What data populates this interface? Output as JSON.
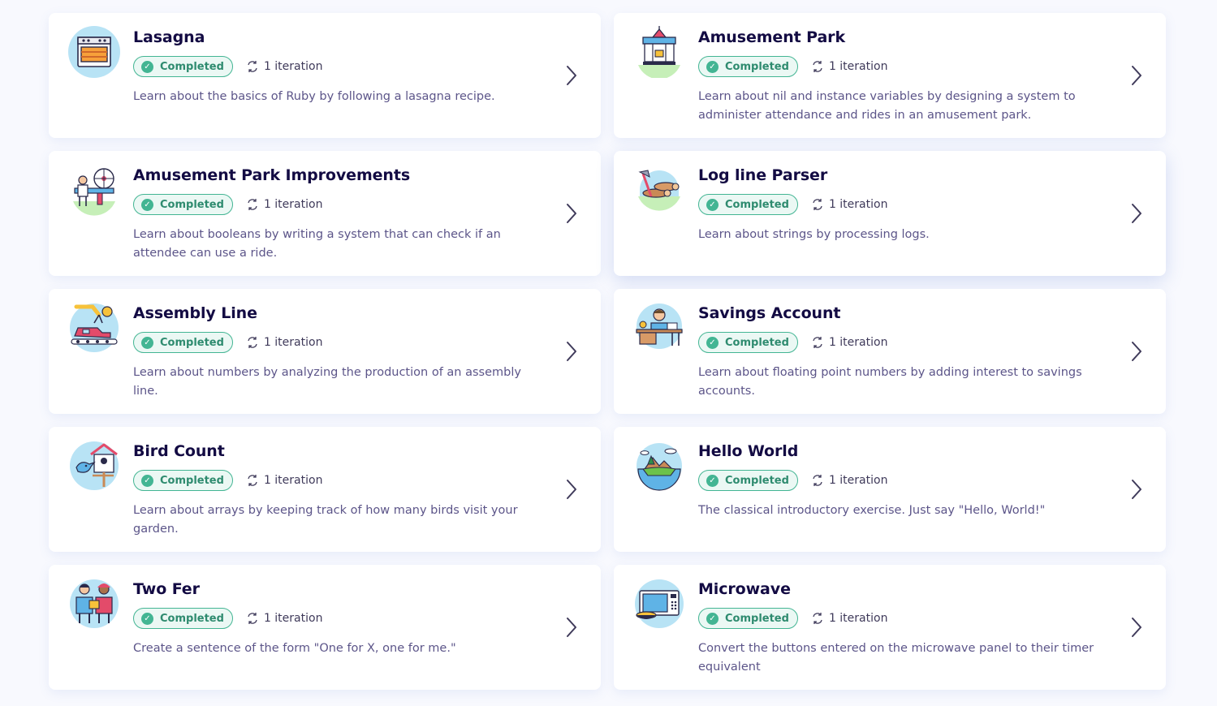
{
  "exercises": [
    {
      "title": "Lasagna",
      "status": "Completed",
      "iterations": "1 iteration",
      "description": "Learn about the basics of Ruby by following a lasagna recipe.",
      "icon": "lasagna-oven-icon",
      "accent": "#b8e3f5"
    },
    {
      "title": "Amusement Park",
      "status": "Completed",
      "iterations": "1 iteration",
      "description": "Learn about nil and instance variables by designing a system to administer attendance and rides in an amusement park.",
      "icon": "amusement-park-icon",
      "accent": "#c6efb8"
    },
    {
      "title": "Amusement Park Improvements",
      "status": "Completed",
      "iterations": "1 iteration",
      "description": "Learn about booleans by writing a system that can check if an attendee can use a ride.",
      "icon": "amusement-park-improvements-icon",
      "accent": "#c6efb8"
    },
    {
      "title": "Log line Parser",
      "status": "Completed",
      "iterations": "1 iteration",
      "description": "Learn about strings by processing logs.",
      "icon": "log-line-parser-icon",
      "accent": "#c6efb8"
    },
    {
      "title": "Assembly Line",
      "status": "Completed",
      "iterations": "1 iteration",
      "description": "Learn about numbers by analyzing the production of an assembly line.",
      "icon": "assembly-line-icon",
      "accent": "#b8e3f5"
    },
    {
      "title": "Savings Account",
      "status": "Completed",
      "iterations": "1 iteration",
      "description": "Learn about floating point numbers by adding interest to savings accounts.",
      "icon": "savings-account-icon",
      "accent": "#b8e3f5"
    },
    {
      "title": "Bird Count",
      "status": "Completed",
      "iterations": "1 iteration",
      "description": "Learn about arrays by keeping track of how many birds visit your garden.",
      "icon": "bird-count-icon",
      "accent": "#b8e3f5"
    },
    {
      "title": "Hello World",
      "status": "Completed",
      "iterations": "1 iteration",
      "description": "The classical introductory exercise. Just say \"Hello, World!\"",
      "icon": "hello-world-globe-icon",
      "accent": "#b8e3f5"
    },
    {
      "title": "Two Fer",
      "status": "Completed",
      "iterations": "1 iteration",
      "description": "Create a sentence of the form \"One for X, one for me.\"",
      "icon": "two-fer-icon",
      "accent": "#b8e3f5"
    },
    {
      "title": "Microwave",
      "status": "Completed",
      "iterations": "1 iteration",
      "description": "Convert the buttons entered on the microwave panel to their timer equivalent",
      "icon": "microwave-icon",
      "accent": "#b8e3f5"
    }
  ],
  "colors": {
    "background": "#f8f9fe",
    "card": "#ffffff",
    "title": "#130b43",
    "description": "#5c5589",
    "completed": "#43b593"
  }
}
